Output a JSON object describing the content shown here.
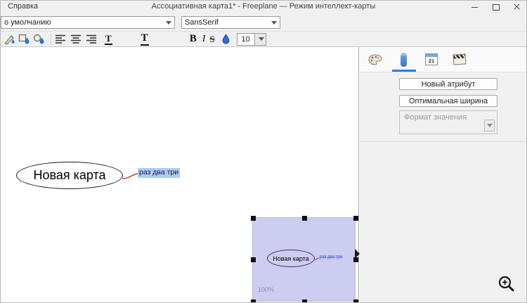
{
  "window": {
    "help_menu": "Справка",
    "title": "Ассоциативная карта1* - Freeplane — Режим интеллект-карты"
  },
  "toolbar": {
    "style_value": "о умолчанию",
    "font_value": "SansSerif",
    "font_size": "10",
    "bold": "B",
    "italic": "I",
    "strikethrough": "S",
    "text_small": "T",
    "text_large": "T"
  },
  "canvas": {
    "root_label": "Новая карта",
    "child_label": "раз два три"
  },
  "preview": {
    "root_label": "Новая карта",
    "child_label": "раз два три",
    "zoom": "100%"
  },
  "panel": {
    "calendar_day": "21",
    "new_attribute_button": "Новый атрибут",
    "optimal_width_button": "Оптимальная ширина",
    "value_format_label": "Формат значения"
  },
  "colors": {
    "accent": "#2d7de0",
    "selection": "#aecdf0",
    "edge": "#b23b3b",
    "preview_fill": "#cdcdf2"
  }
}
